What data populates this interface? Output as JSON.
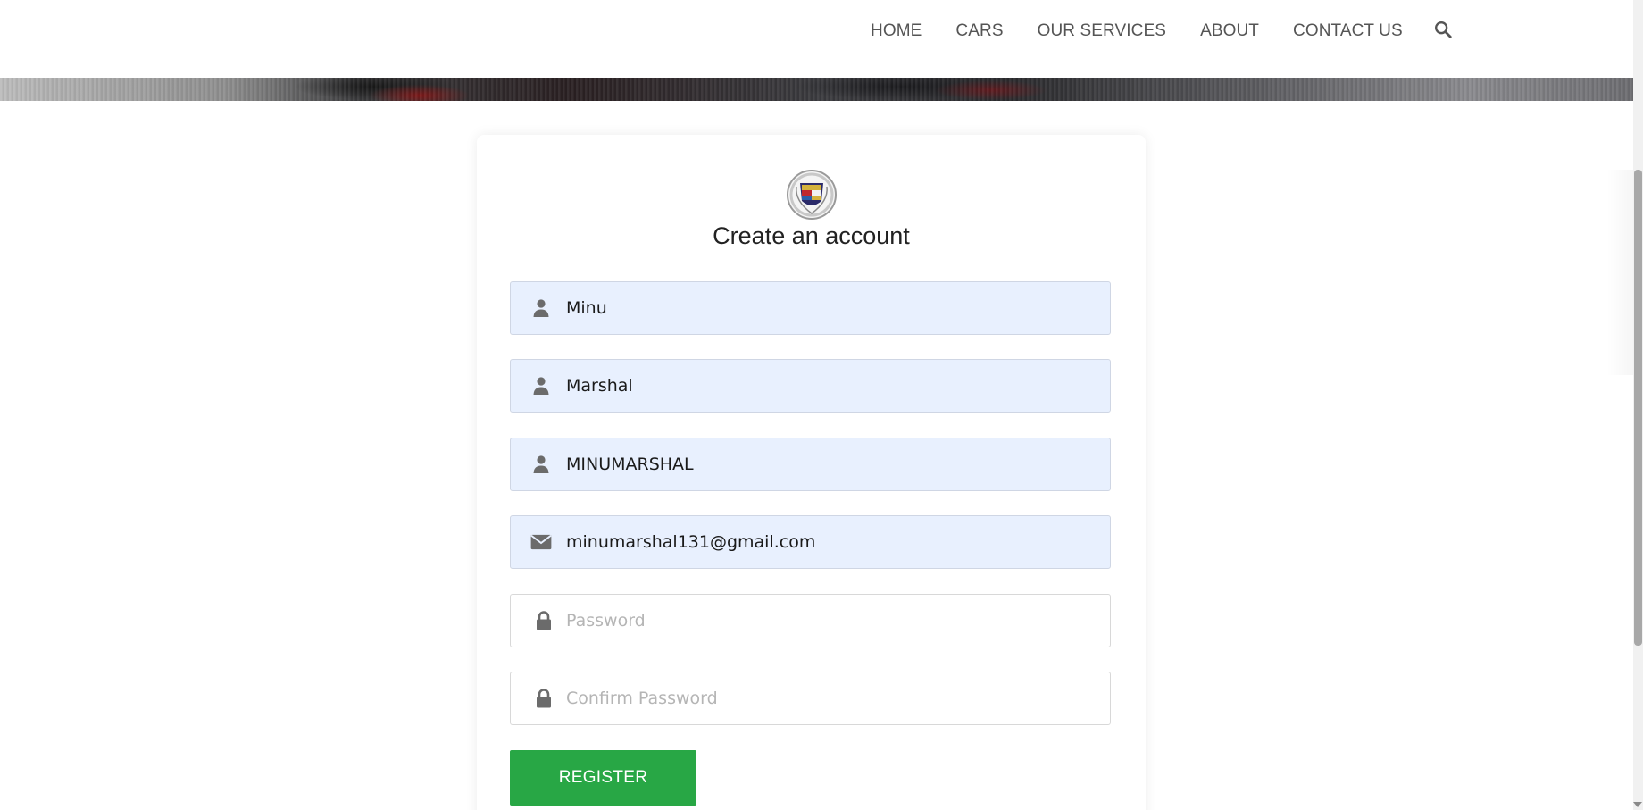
{
  "nav": {
    "items": [
      "HOME",
      "CARS",
      "OUR SERVICES",
      "ABOUT",
      "CONTACT US"
    ],
    "search_icon": "search-icon"
  },
  "form": {
    "emblem_icon": "cadillac-crest-logo",
    "title": "Create an account",
    "first_name": {
      "value": "Minu",
      "icon": "user-icon"
    },
    "last_name": {
      "value": "Marshal",
      "icon": "user-icon"
    },
    "username": {
      "value": "MINUMARSHAL",
      "icon": "user-icon"
    },
    "email": {
      "value": "minumarshal131@gmail.com",
      "icon": "envelope-icon"
    },
    "password": {
      "value": "",
      "placeholder": "Password",
      "icon": "lock-icon"
    },
    "confirm_password": {
      "value": "",
      "placeholder": "Confirm Password",
      "icon": "lock-icon"
    },
    "register_label": "REGISTER"
  },
  "colors": {
    "accent": "#28a745",
    "filled_field_bg": "#e8f0fe",
    "nav_text": "#555555"
  }
}
